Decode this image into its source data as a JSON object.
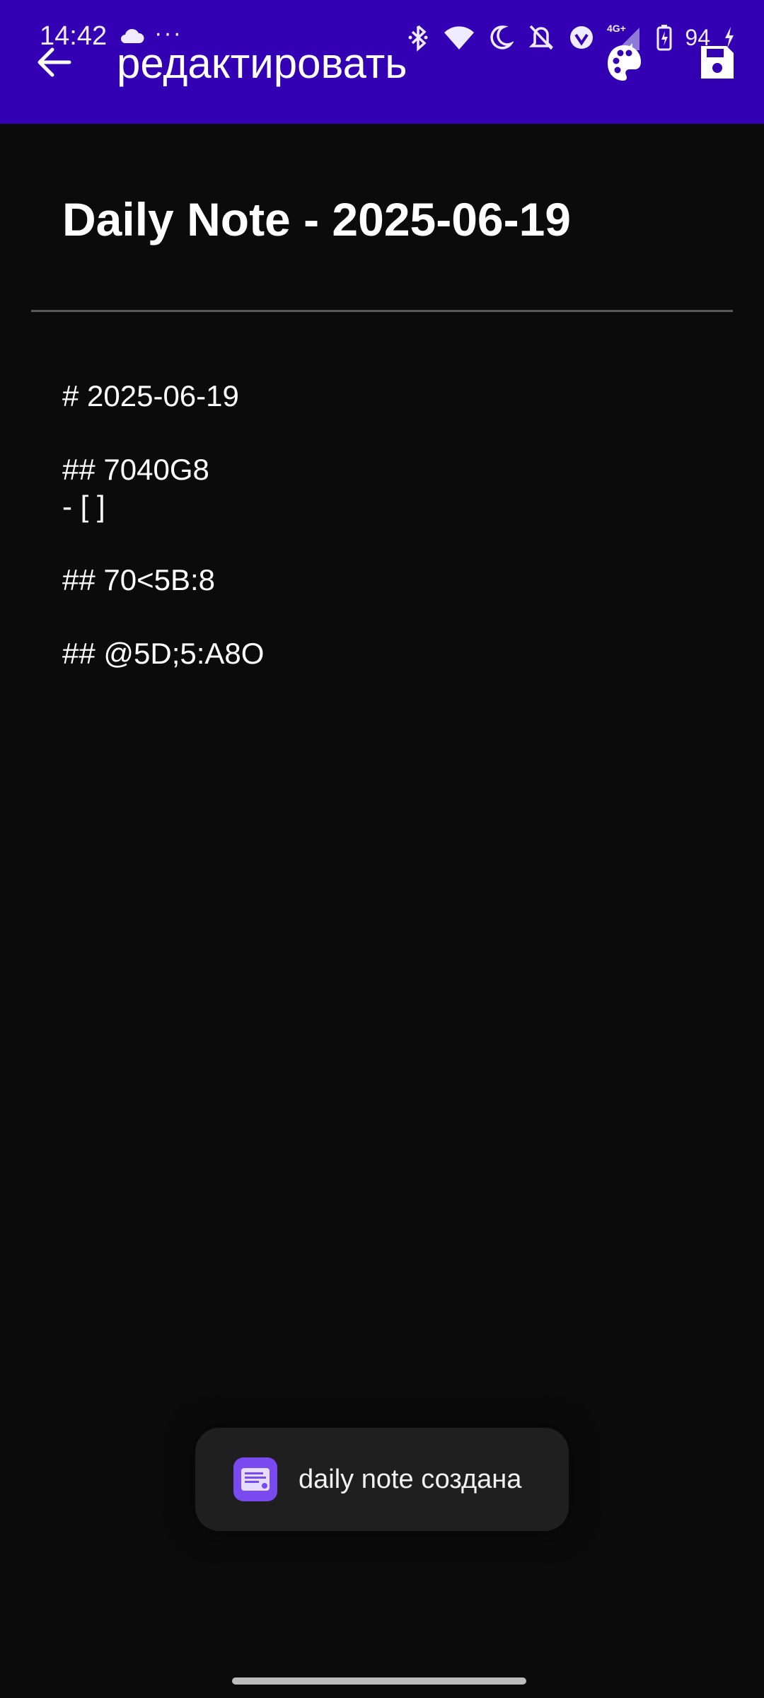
{
  "status_bar": {
    "time": "14:42",
    "more_indicator": "···",
    "network": "4G+",
    "battery_percent": "94",
    "icons": [
      "cloud-icon",
      "bluetooth-icon",
      "wifi-icon",
      "do-not-disturb-moon-icon",
      "vibrate-off-icon",
      "vpn-icon",
      "signal-icon",
      "battery-charging-icon"
    ]
  },
  "app_bar": {
    "title": "редактировать",
    "back_icon": "arrow-left-icon",
    "palette_icon": "palette-icon",
    "save_icon": "save-floppy-icon",
    "background_color": "#3400b4"
  },
  "note": {
    "title": "Daily Note - 2025-06-19",
    "body_lines": [
      "# 2025-06-19",
      "",
      "## 7040G8",
      "- [ ]",
      "",
      "## 70<5B:8",
      "",
      "## @5D;5:A8O"
    ]
  },
  "toast": {
    "message": "daily note создана",
    "icon": "note-app-icon",
    "icon_color": "#7a4af0"
  }
}
